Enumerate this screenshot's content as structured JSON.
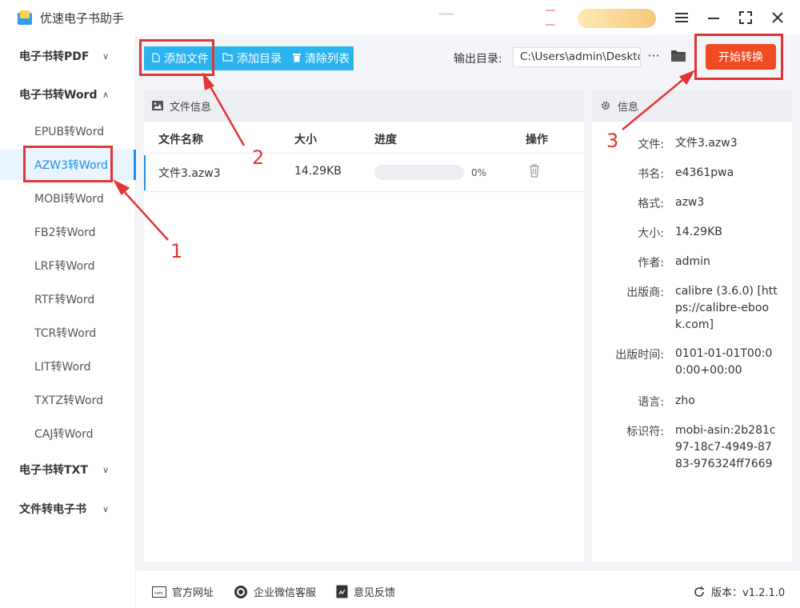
{
  "app": {
    "title": "优速电子书助手"
  },
  "window_controls": [
    "menu-icon",
    "minimize-icon",
    "maximize-icon",
    "close-icon"
  ],
  "sidebar": {
    "groups": [
      {
        "label": "电子书转PDF",
        "expanded": false
      },
      {
        "label": "电子书转Word",
        "expanded": true
      },
      {
        "label": "电子书转TXT",
        "expanded": false
      },
      {
        "label": "文件转电子书",
        "expanded": false
      }
    ],
    "items": [
      "EPUB转Word",
      "AZW3转Word",
      "MOBI转Word",
      "FB2转Word",
      "LRF转Word",
      "RTF转Word",
      "TCR转Word",
      "LIT转Word",
      "TXTZ转Word",
      "CAJ转Word"
    ],
    "active_item": "AZW3转Word"
  },
  "toolbar": {
    "add_file": "添加文件",
    "add_folder": "添加目录",
    "clear_list": "清除列表",
    "output_label": "输出目录:",
    "output_path": "C:\\Users\\admin\\Desktop",
    "more": "···",
    "start": "开始转换"
  },
  "file_panel": {
    "title": "文件信息",
    "columns": {
      "name": "文件名称",
      "size": "大小",
      "progress": "进度",
      "action": "操作"
    },
    "rows": [
      {
        "name": "文件3.azw3",
        "size": "14.29KB",
        "progress": 0,
        "progress_label": "0%"
      }
    ]
  },
  "info_panel": {
    "title": "信息",
    "fields": [
      {
        "key": "文件:",
        "value": "文件3.azw3"
      },
      {
        "key": "书名:",
        "value": "e4361pwa"
      },
      {
        "key": "格式:",
        "value": "azw3"
      },
      {
        "key": "大小:",
        "value": "14.29KB"
      },
      {
        "key": "作者:",
        "value": "admin"
      },
      {
        "key": "出版商:",
        "value": "calibre (3.6.0) [https://calibre-ebook.com]"
      },
      {
        "key": "出版时间:",
        "value": "0101-01-01T00:00:00+00:00"
      },
      {
        "key": "语言:",
        "value": "zho"
      },
      {
        "key": "标识符:",
        "value": "mobi-asin:2b281c97-18c7-4949-8783-976324ff7669"
      }
    ]
  },
  "footer": {
    "website": "官方网址",
    "wechat": "企业微信客服",
    "feedback": "意见反馈",
    "version": "版本：v1.2.1.0"
  },
  "annotations": {
    "n1": "1",
    "n2": "2",
    "n3": "3"
  },
  "colors": {
    "accent_blue": "#2bb3ee",
    "active_blue": "#1e8fe6",
    "start_red": "#f04b22",
    "annotation_red": "#e33535"
  }
}
